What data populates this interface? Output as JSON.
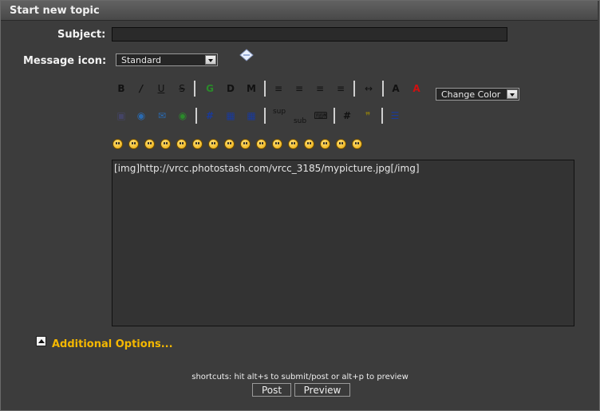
{
  "form": {
    "title": "Start new topic",
    "subject_label": "Subject:",
    "subject_value": "",
    "icon_label": "Message icon:",
    "icon_value": "Standard"
  },
  "toolbar": {
    "change_color": "Change Color",
    "row1": [
      {
        "name": "bold-icon",
        "glyph": "B"
      },
      {
        "name": "italic-icon",
        "glyph": "/"
      },
      {
        "name": "underline-icon",
        "glyph": "U"
      },
      {
        "name": "strikethrough-icon",
        "glyph": "S"
      },
      {
        "name": "glow-icon",
        "glyph": "G"
      },
      {
        "name": "shadow-icon",
        "glyph": "D"
      },
      {
        "name": "marquee-icon",
        "glyph": "M"
      },
      {
        "name": "align-left-icon",
        "glyph": "≡"
      },
      {
        "name": "align-justify-icon",
        "glyph": "≡"
      },
      {
        "name": "align-center-icon",
        "glyph": "≡"
      },
      {
        "name": "align-right-icon",
        "glyph": "≡"
      },
      {
        "name": "horizontal-rule-icon",
        "glyph": "↔"
      },
      {
        "name": "font-size-icon",
        "glyph": "A"
      },
      {
        "name": "font-face-icon",
        "glyph": "A"
      }
    ],
    "row2": [
      {
        "name": "insert-image-icon",
        "glyph": "▣"
      },
      {
        "name": "insert-hyperlink-icon",
        "glyph": "◉"
      },
      {
        "name": "insert-email-icon",
        "glyph": "✉"
      },
      {
        "name": "insert-ftp-icon",
        "glyph": "◉"
      },
      {
        "name": "insert-table-icon",
        "glyph": "#"
      },
      {
        "name": "insert-table-row-icon",
        "glyph": "▦"
      },
      {
        "name": "insert-table-column-icon",
        "glyph": "▦"
      },
      {
        "name": "superscript-icon",
        "glyph": "sup"
      },
      {
        "name": "subscript-icon",
        "glyph": "sub"
      },
      {
        "name": "teletype-icon",
        "glyph": "⌨"
      },
      {
        "name": "insert-code-icon",
        "glyph": "#"
      },
      {
        "name": "insert-quote-icon",
        "glyph": "❞"
      },
      {
        "name": "insert-list-icon",
        "glyph": "☰"
      }
    ],
    "smileys": [
      "smiley-icon",
      "wink-icon",
      "cheesy-icon",
      "grin-icon",
      "angry-icon",
      "sad-icon",
      "shocked-icon",
      "cool-icon",
      "huh-icon",
      "rolleyes-icon",
      "tongue-icon",
      "embarrassed-icon",
      "lipsrsealed-icon",
      "undecided-icon",
      "kiss-icon",
      "cry-icon"
    ]
  },
  "message": {
    "body": "[img]http://vrcc.photostash.com/vrcc_3185/mypicture.jpg[/img]"
  },
  "options": {
    "label": "Additional Options..."
  },
  "footer": {
    "shortcuts": "shortcuts: hit alt+s to submit/post or alt+p to preview",
    "post_label": "Post",
    "preview_label": "Preview"
  }
}
